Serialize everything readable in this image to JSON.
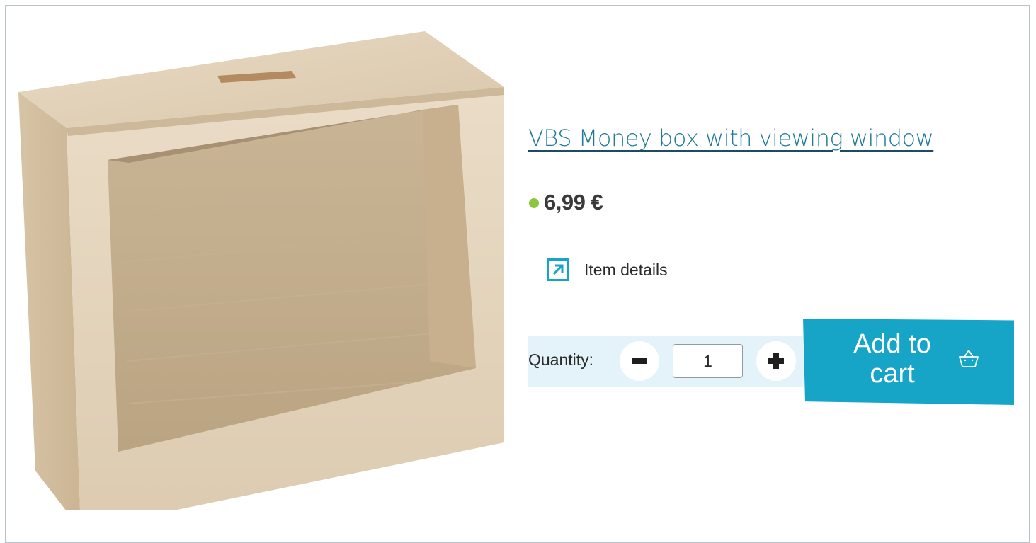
{
  "product": {
    "title": "VBS Money box with viewing window",
    "price": "6,99 €",
    "availability_color": "#8cc63f",
    "details_label": "Item details",
    "details_icon": "external-arrow-icon"
  },
  "quantity": {
    "label": "Quantity:",
    "value": "1",
    "decrement_icon": "minus-icon",
    "increment_icon": "plus-icon"
  },
  "cart": {
    "label_line1": "Add to",
    "label_line2": "cart",
    "icon": "basket-icon",
    "color": "#17a5c7"
  },
  "colors": {
    "title": "#1f7a98",
    "accent": "#17a5c7",
    "panel": "#e3f3f9"
  }
}
